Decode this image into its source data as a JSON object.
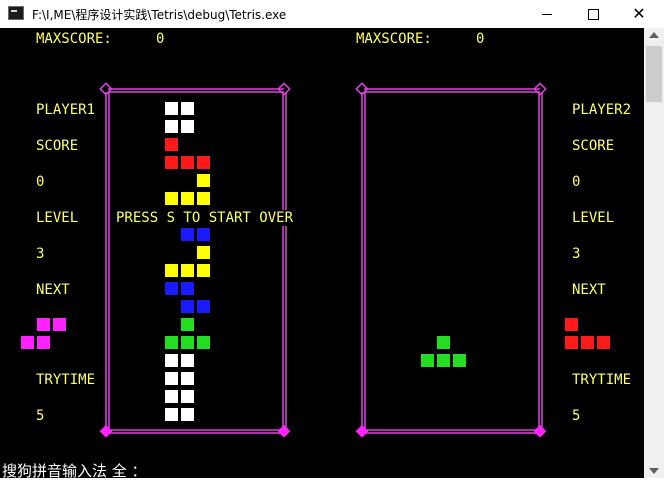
{
  "window": {
    "title": "F:\\I,ME\\程序设计实践\\Tetris\\debug\\Tetris.exe",
    "minimize_label": "—",
    "maximize_label": "☐",
    "close_label": "✕"
  },
  "colors": {
    "background": "#000000",
    "text": "#ffff66",
    "border": "#e040e0",
    "white": "#ffffff",
    "red": "#ff1a1a",
    "yellow": "#ffff00",
    "blue": "#1a1aff",
    "green": "#22dd22",
    "magenta": "#ff22ff"
  },
  "player1": {
    "maxscore_label": "MAXSCORE:",
    "maxscore_value": "0",
    "name": "PLAYER1",
    "score_label": "SCORE",
    "score_value": "0",
    "level_label": "LEVEL",
    "level_value": "3",
    "next_label": "NEXT",
    "next_piece_color": "magenta",
    "trytime_label": "TRYTIME",
    "trytime_value": "5",
    "message": "PRESS S TO START OVER"
  },
  "player2": {
    "maxscore_label": "MAXSCORE:",
    "maxscore_value": "0",
    "name": "PLAYER2",
    "score_label": "SCORE",
    "score_value": "0",
    "level_label": "LEVEL",
    "level_value": "3",
    "next_label": "NEXT",
    "next_piece_color": "red",
    "trytime_label": "TRYTIME",
    "trytime_value": "5"
  },
  "ime_status": "搜狗拼音输入法 全 ："
}
